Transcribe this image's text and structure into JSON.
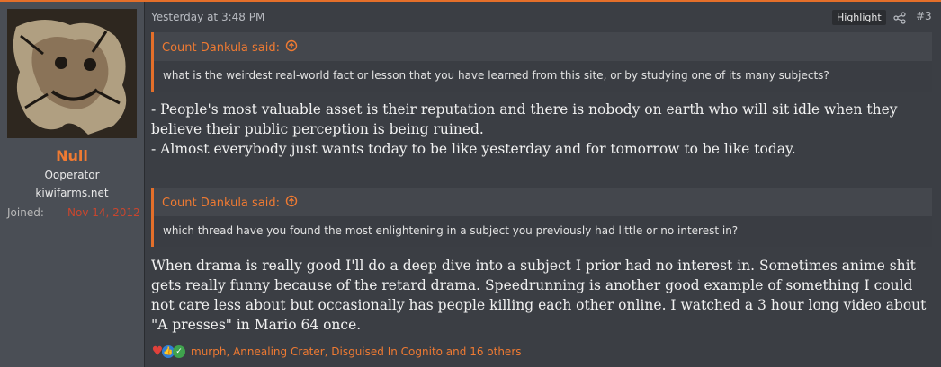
{
  "user": {
    "name": "Null",
    "title": "Ooperator",
    "site": "kiwifarms.net",
    "joined_label": "Joined:",
    "joined_value": "Nov 14, 2012"
  },
  "post": {
    "timestamp": "Yesterday at 3:48 PM",
    "highlight_label": "Highlight",
    "number": "#3",
    "quote1": {
      "author": "Count Dankula said:",
      "text": "what is the weirdest real-world fact or lesson that you have learned from this site, or by studying one of its many subjects?"
    },
    "message1": "- People's most valuable asset is their reputation and there is nobody on earth who will sit idle when they believe their public perception is being ruined.\n- Almost everybody just wants today to be like yesterday and for tomorrow to be like today.",
    "quote2": {
      "author": "Count Dankula said:",
      "text": "which thread have you found the most enlightening in a subject you previously had little or no interest in?"
    },
    "message2": "When drama is really good I'll do a deep dive into a subject I prior had no interest in. Sometimes anime shit gets really funny because of the retard drama. Speedrunning is another good example of something I could not care less about but occasionally has people killing each other online. I watched a 3 hour long video about \"A presses\" in Mario 64 once.",
    "reactions_text": "murph, Annealing Crater, Disguised In Cognito and 16 others"
  },
  "icons": {
    "quote_jump": "arrow-up-circle-icon",
    "share": "share-icon",
    "reactions": [
      "heart-icon",
      "like-icon",
      "check-icon"
    ]
  },
  "colors": {
    "accent": "#e46f2a",
    "username": "#ef7a32",
    "joined_date": "#c9462e"
  }
}
